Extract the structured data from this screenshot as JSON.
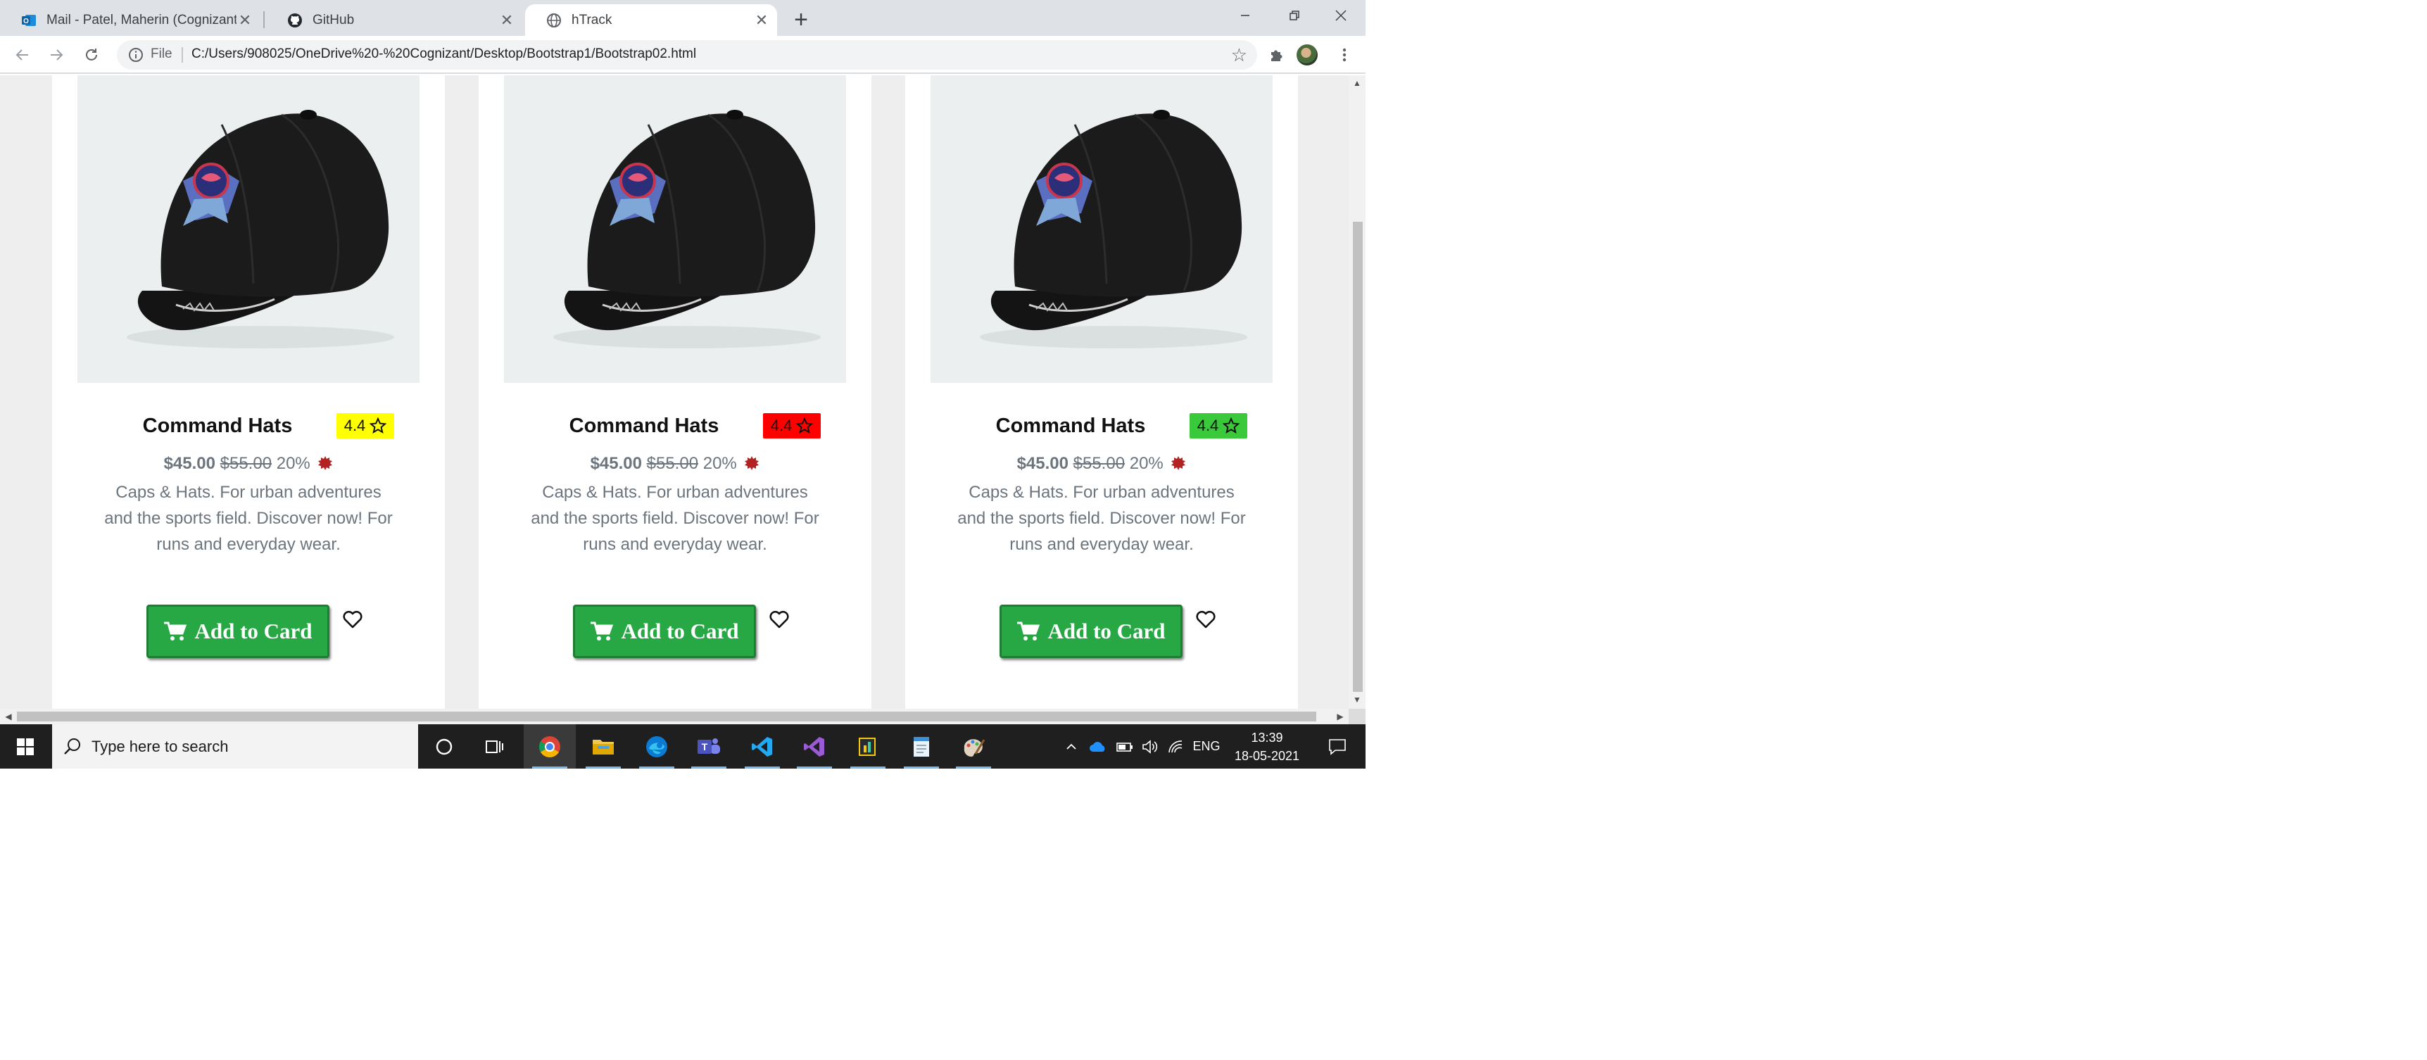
{
  "browser": {
    "tabs": [
      {
        "title": "Mail - Patel, Maherin (Cognizant)",
        "icon": "outlook-icon",
        "active": false
      },
      {
        "title": "GitHub",
        "icon": "github-icon",
        "active": false
      },
      {
        "title": "hTrack",
        "icon": "globe-icon",
        "active": true
      }
    ],
    "address": {
      "scheme_label": "File",
      "url": "C:/Users/908025/OneDrive%20-%20Cognizant/Desktop/Bootstrap1/Bootstrap02.html"
    }
  },
  "products": [
    {
      "title": "Command Hats",
      "rating": "4.4",
      "rating_color": "#ffff00",
      "price": "$45.00",
      "old_price": "$55.00",
      "discount": "20%",
      "description": "Caps & Hats. For urban adventures and the sports field. Discover now! For runs and everyday wear.",
      "button_label": "Add to Card"
    },
    {
      "title": "Command Hats",
      "rating": "4.4",
      "rating_color": "#ff0000",
      "price": "$45.00",
      "old_price": "$55.00",
      "discount": "20%",
      "description": "Caps & Hats. For urban adventures and the sports field. Discover now! For runs and everyday wear.",
      "button_label": "Add to Card"
    },
    {
      "title": "Command Hats",
      "rating": "4.4",
      "rating_color": "#3ac93a",
      "price": "$45.00",
      "old_price": "$55.00",
      "discount": "20%",
      "description": "Caps & Hats. For urban adventures and the sports field. Discover now! For runs and everyday wear.",
      "button_label": "Add to Card"
    }
  ],
  "colors": {
    "button_green": "#28a745",
    "page_bg": "#eeeeee",
    "sale_badge": "#b22222"
  },
  "taskbar": {
    "search_placeholder": "Type here to search",
    "language": "ENG",
    "time": "13:39",
    "date": "18-05-2021"
  }
}
